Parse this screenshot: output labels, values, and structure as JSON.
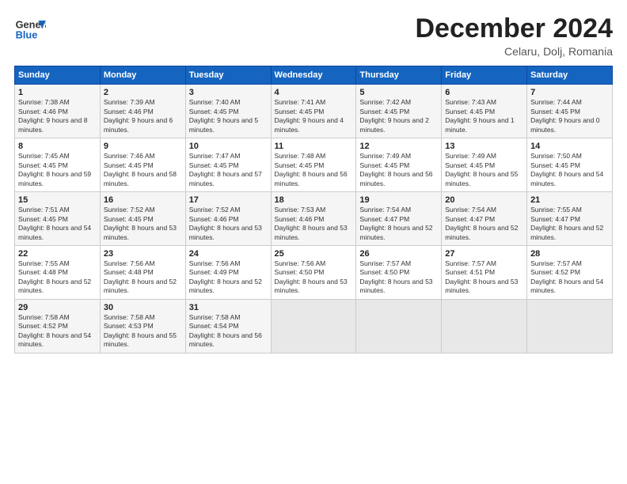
{
  "header": {
    "logo_general": "General",
    "logo_blue": "Blue",
    "title": "December 2024",
    "location": "Celaru, Dolj, Romania"
  },
  "days_of_week": [
    "Sunday",
    "Monday",
    "Tuesday",
    "Wednesday",
    "Thursday",
    "Friday",
    "Saturday"
  ],
  "weeks": [
    [
      {
        "day": "1",
        "sunrise": "Sunrise: 7:38 AM",
        "sunset": "Sunset: 4:46 PM",
        "daylight": "Daylight: 9 hours and 8 minutes."
      },
      {
        "day": "2",
        "sunrise": "Sunrise: 7:39 AM",
        "sunset": "Sunset: 4:46 PM",
        "daylight": "Daylight: 9 hours and 6 minutes."
      },
      {
        "day": "3",
        "sunrise": "Sunrise: 7:40 AM",
        "sunset": "Sunset: 4:45 PM",
        "daylight": "Daylight: 9 hours and 5 minutes."
      },
      {
        "day": "4",
        "sunrise": "Sunrise: 7:41 AM",
        "sunset": "Sunset: 4:45 PM",
        "daylight": "Daylight: 9 hours and 4 minutes."
      },
      {
        "day": "5",
        "sunrise": "Sunrise: 7:42 AM",
        "sunset": "Sunset: 4:45 PM",
        "daylight": "Daylight: 9 hours and 2 minutes."
      },
      {
        "day": "6",
        "sunrise": "Sunrise: 7:43 AM",
        "sunset": "Sunset: 4:45 PM",
        "daylight": "Daylight: 9 hours and 1 minute."
      },
      {
        "day": "7",
        "sunrise": "Sunrise: 7:44 AM",
        "sunset": "Sunset: 4:45 PM",
        "daylight": "Daylight: 9 hours and 0 minutes."
      }
    ],
    [
      {
        "day": "8",
        "sunrise": "Sunrise: 7:45 AM",
        "sunset": "Sunset: 4:45 PM",
        "daylight": "Daylight: 8 hours and 59 minutes."
      },
      {
        "day": "9",
        "sunrise": "Sunrise: 7:46 AM",
        "sunset": "Sunset: 4:45 PM",
        "daylight": "Daylight: 8 hours and 58 minutes."
      },
      {
        "day": "10",
        "sunrise": "Sunrise: 7:47 AM",
        "sunset": "Sunset: 4:45 PM",
        "daylight": "Daylight: 8 hours and 57 minutes."
      },
      {
        "day": "11",
        "sunrise": "Sunrise: 7:48 AM",
        "sunset": "Sunset: 4:45 PM",
        "daylight": "Daylight: 8 hours and 56 minutes."
      },
      {
        "day": "12",
        "sunrise": "Sunrise: 7:49 AM",
        "sunset": "Sunset: 4:45 PM",
        "daylight": "Daylight: 8 hours and 56 minutes."
      },
      {
        "day": "13",
        "sunrise": "Sunrise: 7:49 AM",
        "sunset": "Sunset: 4:45 PM",
        "daylight": "Daylight: 8 hours and 55 minutes."
      },
      {
        "day": "14",
        "sunrise": "Sunrise: 7:50 AM",
        "sunset": "Sunset: 4:45 PM",
        "daylight": "Daylight: 8 hours and 54 minutes."
      }
    ],
    [
      {
        "day": "15",
        "sunrise": "Sunrise: 7:51 AM",
        "sunset": "Sunset: 4:45 PM",
        "daylight": "Daylight: 8 hours and 54 minutes."
      },
      {
        "day": "16",
        "sunrise": "Sunrise: 7:52 AM",
        "sunset": "Sunset: 4:45 PM",
        "daylight": "Daylight: 8 hours and 53 minutes."
      },
      {
        "day": "17",
        "sunrise": "Sunrise: 7:52 AM",
        "sunset": "Sunset: 4:46 PM",
        "daylight": "Daylight: 8 hours and 53 minutes."
      },
      {
        "day": "18",
        "sunrise": "Sunrise: 7:53 AM",
        "sunset": "Sunset: 4:46 PM",
        "daylight": "Daylight: 8 hours and 53 minutes."
      },
      {
        "day": "19",
        "sunrise": "Sunrise: 7:54 AM",
        "sunset": "Sunset: 4:47 PM",
        "daylight": "Daylight: 8 hours and 52 minutes."
      },
      {
        "day": "20",
        "sunrise": "Sunrise: 7:54 AM",
        "sunset": "Sunset: 4:47 PM",
        "daylight": "Daylight: 8 hours and 52 minutes."
      },
      {
        "day": "21",
        "sunrise": "Sunrise: 7:55 AM",
        "sunset": "Sunset: 4:47 PM",
        "daylight": "Daylight: 8 hours and 52 minutes."
      }
    ],
    [
      {
        "day": "22",
        "sunrise": "Sunrise: 7:55 AM",
        "sunset": "Sunset: 4:48 PM",
        "daylight": "Daylight: 8 hours and 52 minutes."
      },
      {
        "day": "23",
        "sunrise": "Sunrise: 7:56 AM",
        "sunset": "Sunset: 4:48 PM",
        "daylight": "Daylight: 8 hours and 52 minutes."
      },
      {
        "day": "24",
        "sunrise": "Sunrise: 7:56 AM",
        "sunset": "Sunset: 4:49 PM",
        "daylight": "Daylight: 8 hours and 52 minutes."
      },
      {
        "day": "25",
        "sunrise": "Sunrise: 7:56 AM",
        "sunset": "Sunset: 4:50 PM",
        "daylight": "Daylight: 8 hours and 53 minutes."
      },
      {
        "day": "26",
        "sunrise": "Sunrise: 7:57 AM",
        "sunset": "Sunset: 4:50 PM",
        "daylight": "Daylight: 8 hours and 53 minutes."
      },
      {
        "day": "27",
        "sunrise": "Sunrise: 7:57 AM",
        "sunset": "Sunset: 4:51 PM",
        "daylight": "Daylight: 8 hours and 53 minutes."
      },
      {
        "day": "28",
        "sunrise": "Sunrise: 7:57 AM",
        "sunset": "Sunset: 4:52 PM",
        "daylight": "Daylight: 8 hours and 54 minutes."
      }
    ],
    [
      {
        "day": "29",
        "sunrise": "Sunrise: 7:58 AM",
        "sunset": "Sunset: 4:52 PM",
        "daylight": "Daylight: 8 hours and 54 minutes."
      },
      {
        "day": "30",
        "sunrise": "Sunrise: 7:58 AM",
        "sunset": "Sunset: 4:53 PM",
        "daylight": "Daylight: 8 hours and 55 minutes."
      },
      {
        "day": "31",
        "sunrise": "Sunrise: 7:58 AM",
        "sunset": "Sunset: 4:54 PM",
        "daylight": "Daylight: 8 hours and 56 minutes."
      },
      null,
      null,
      null,
      null
    ]
  ]
}
